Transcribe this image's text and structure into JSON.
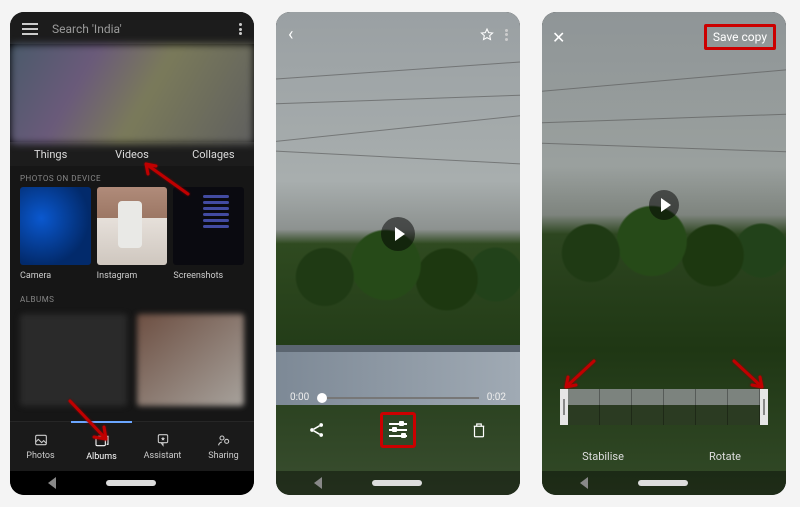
{
  "screen1": {
    "search_placeholder": "Search 'India'",
    "categories": {
      "things": "Things",
      "videos": "Videos",
      "collages": "Collages"
    },
    "section_device": "PHOTOS ON DEVICE",
    "device_folders": {
      "camera": "Camera",
      "instagram": "Instagram",
      "screenshots": "Screenshots"
    },
    "section_albums": "ALBUMS",
    "bottom_nav": {
      "photos": "Photos",
      "albums": "Albums",
      "assistant": "Assistant",
      "sharing": "Sharing"
    }
  },
  "screen2": {
    "time_current": "0:00",
    "time_total": "0:02"
  },
  "screen3": {
    "save_copy": "Save copy",
    "stabilise": "Stabilise",
    "rotate": "Rotate"
  },
  "annotations": {
    "arrow_color": "#c00000",
    "highlight_color": "#c00000"
  }
}
